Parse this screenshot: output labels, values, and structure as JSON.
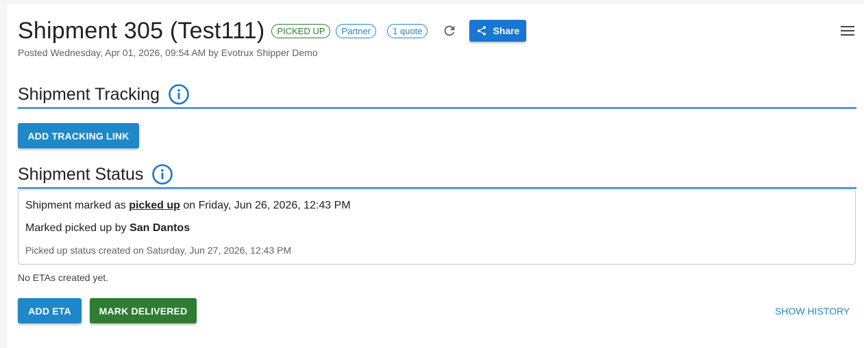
{
  "header": {
    "title": "Shipment 305 (Test111)",
    "chips": {
      "status": "PICKED UP",
      "partner": "Partner",
      "quotes": "1 quote"
    },
    "share_label": "Share",
    "posted": "Posted Wednesday, Apr 01, 2026, 09:54 AM by Evotrux Shipper Demo"
  },
  "tracking": {
    "title": "Shipment Tracking",
    "add_button": "ADD TRACKING LINK"
  },
  "status": {
    "title": "Shipment Status",
    "line1_prefix": "Shipment marked as ",
    "line1_link": "picked up",
    "line1_suffix": " on Friday, Jun 26, 2026, 12:43 PM",
    "line2_prefix": "Marked picked up by ",
    "line2_name": "San Dantos",
    "line3": "Picked up status created on Saturday, Jun 27, 2026, 12:43 PM"
  },
  "eta": {
    "empty_text": "No ETAs created yet.",
    "add_button": "ADD ETA",
    "mark_delivered_button": "MARK DELIVERED",
    "show_history": "SHOW HISTORY"
  },
  "icons": {
    "refresh": "refresh-icon",
    "share": "share-icon",
    "menu": "menu-icon",
    "info": "info-icon"
  },
  "colors": {
    "primary": "#1976d2",
    "accent_blue": "#1e88c8",
    "success_green": "#2e7d32"
  }
}
